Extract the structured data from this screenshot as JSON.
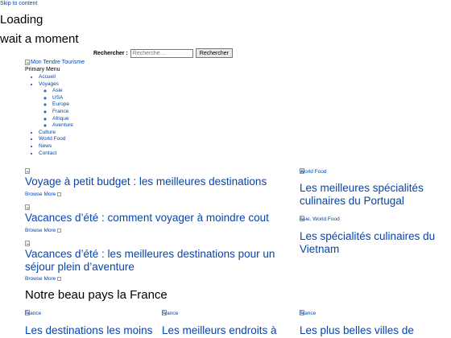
{
  "skip_link": "Skip to content",
  "loading": {
    "title": "Loading",
    "subtitle": "wait a moment"
  },
  "search": {
    "label": "Rechercher :",
    "placeholder": "Recherche…",
    "button": "Rechercher"
  },
  "logo_alt": "Mon Tendre Tourisme",
  "menu": {
    "title": "Primary Menu",
    "items": [
      {
        "label": "Accueil"
      },
      {
        "label": "Voyages",
        "children": [
          "Asie",
          "USA",
          "Europe",
          "France",
          "Afrique",
          "Aventure"
        ]
      },
      {
        "label": "Culture"
      },
      {
        "label": "World Food"
      },
      {
        "label": "News"
      },
      {
        "label": "Contact"
      }
    ]
  },
  "main_posts": [
    {
      "title": "Voyage à petit budget : les meilleures destinations",
      "more": "Browse More"
    },
    {
      "title": "Vacances d’été : comment voyager à moindre cout",
      "more": "Browse More"
    },
    {
      "title": "Vacances d’été : les meilleures destinations pour un séjour plein d’aventure",
      "more": "Browse More"
    }
  ],
  "side_posts": [
    {
      "category": "World Food",
      "title": "Les meilleures spécialités culinaires du Portugal"
    },
    {
      "category": "Asie, World Food",
      "title": "Les spécialités culinaires du Vietnam"
    }
  ],
  "section": {
    "title": "Notre beau pays la France",
    "posts": [
      {
        "category": "France",
        "title": "Les destinations les moins"
      },
      {
        "category": "France",
        "title": "Les meilleurs endroits à"
      },
      {
        "category": "France",
        "title": "Les plus belles villes de"
      }
    ]
  },
  "colors": {
    "link": "#0645ad",
    "text": "#000000",
    "background": "#ffffff"
  },
  "icons": {
    "broken_image": "broken-image-icon",
    "arrow": "arrow-icon"
  }
}
